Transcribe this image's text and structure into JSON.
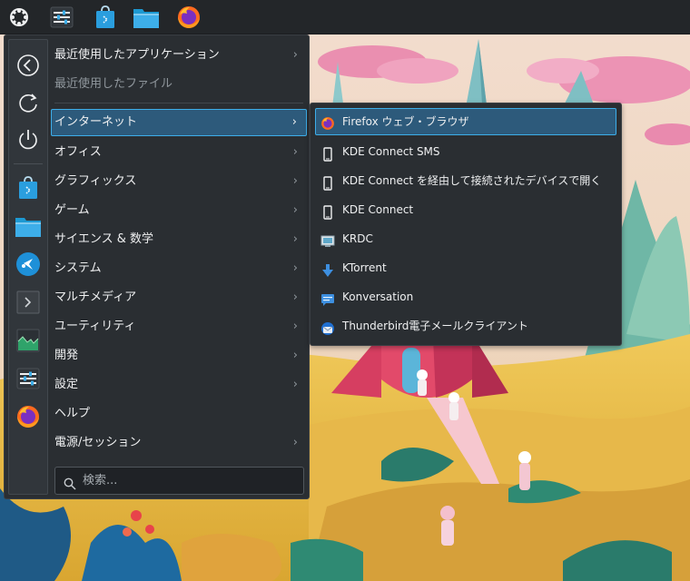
{
  "menu": {
    "items": [
      {
        "label": "最近使用したアプリケーション",
        "arrow": "›"
      },
      {
        "label": "最近使用したファイル"
      },
      {
        "label": "インターネット",
        "arrow": "›"
      },
      {
        "label": "オフィス",
        "arrow": "›"
      },
      {
        "label": "グラフィックス",
        "arrow": "›"
      },
      {
        "label": "ゲーム",
        "arrow": "›"
      },
      {
        "label": "サイエンス & 数学",
        "arrow": "›"
      },
      {
        "label": "システム",
        "arrow": "›"
      },
      {
        "label": "マルチメディア",
        "arrow": "›"
      },
      {
        "label": "ユーティリティ",
        "arrow": "›"
      },
      {
        "label": "開発",
        "arrow": "›"
      },
      {
        "label": "設定",
        "arrow": "›"
      },
      {
        "label": "ヘルプ"
      },
      {
        "label": "電源/セッション",
        "arrow": "›"
      }
    ],
    "selected_label": "インターネット",
    "search": {
      "placeholder": "検索..."
    }
  },
  "submenu": {
    "items": [
      {
        "label": "Firefox ウェブ・ブラウザ",
        "icon": "firefox-icon"
      },
      {
        "label": "KDE Connect SMS",
        "icon": "phone-icon"
      },
      {
        "label": "KDE Connect を経由して接続されたデバイスで開く",
        "icon": "phone-icon"
      },
      {
        "label": "KDE Connect",
        "icon": "phone-icon"
      },
      {
        "label": "KRDC",
        "icon": "remote-desktop-icon"
      },
      {
        "label": "KTorrent",
        "icon": "download-arrow-icon"
      },
      {
        "label": "Konversation",
        "icon": "chat-icon"
      },
      {
        "label": "Thunderbird電子メールクライアント",
        "icon": "thunderbird-icon"
      }
    ],
    "selected_label": "Firefox ウェブ・ブラウザ"
  },
  "panel": {
    "icons": [
      "app-launcher-icon",
      "settings-sliders-icon",
      "discover-store-icon",
      "file-manager-icon",
      "firefox-icon"
    ]
  },
  "rail": {
    "icons": [
      "back-icon",
      "restart-icon",
      "power-icon",
      "discover-store-icon",
      "file-manager-icon",
      "kde-connect-icon",
      "terminal-icon",
      "system-monitor-icon",
      "settings-sliders-icon",
      "firefox-icon"
    ]
  },
  "colors": {
    "accent": "#3daee9",
    "selection": "#2d5a7b",
    "menu_bg": "#2a2e32",
    "panel_bg": "#232629"
  }
}
